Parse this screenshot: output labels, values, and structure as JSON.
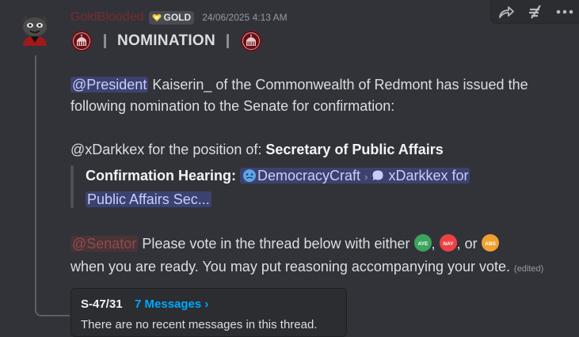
{
  "message": {
    "username": "GoldBlooded",
    "tag": {
      "label": "GOLD",
      "icon": "heart-icon"
    },
    "timestamp": "24/06/2025 4:13 AM",
    "title": "NOMINATION",
    "body": {
      "mention_president": "@President",
      "line1_rest": " Kaiserin_ of the Commonwealth of Redmont has issued the",
      "line2": "following nomination to the Senate for confirmation:",
      "nominee_prefix": "@xDarkkex for the position of: ",
      "position": "Secretary of Public Affairs",
      "quote_label": "Confirmation Hearing:",
      "quote_server": "DemocracyCraft",
      "quote_sep": "›",
      "quote_thread_1": "xDarkkex for",
      "quote_thread_2": "Public Affairs Sec...",
      "mention_senator": "@Senator",
      "vote_line_a": " Please vote in the thread below with either ",
      "comma1": ",",
      "comma2": ", or",
      "vote_line_b": "when you are ready. You may put reasoning accompanying your vote.",
      "edited": "(edited)",
      "votes": [
        {
          "label": "AYE",
          "color": "#3ba55c"
        },
        {
          "label": "NAY",
          "color": "#ed4245"
        },
        {
          "label": "ABS",
          "color": "#f0a030"
        }
      ]
    }
  },
  "thread": {
    "name": "S-47/31",
    "count": "7 Messages ›",
    "subtitle": "There are no recent messages in this thread."
  },
  "toolbar": {
    "icons": [
      "reply-arrow-icon",
      "thread-icon",
      "more-icon"
    ]
  },
  "colors": {
    "background": "#323339",
    "username": "#7a2b2f",
    "mention_bg": "#3c4270",
    "link": "#00a8fc"
  }
}
